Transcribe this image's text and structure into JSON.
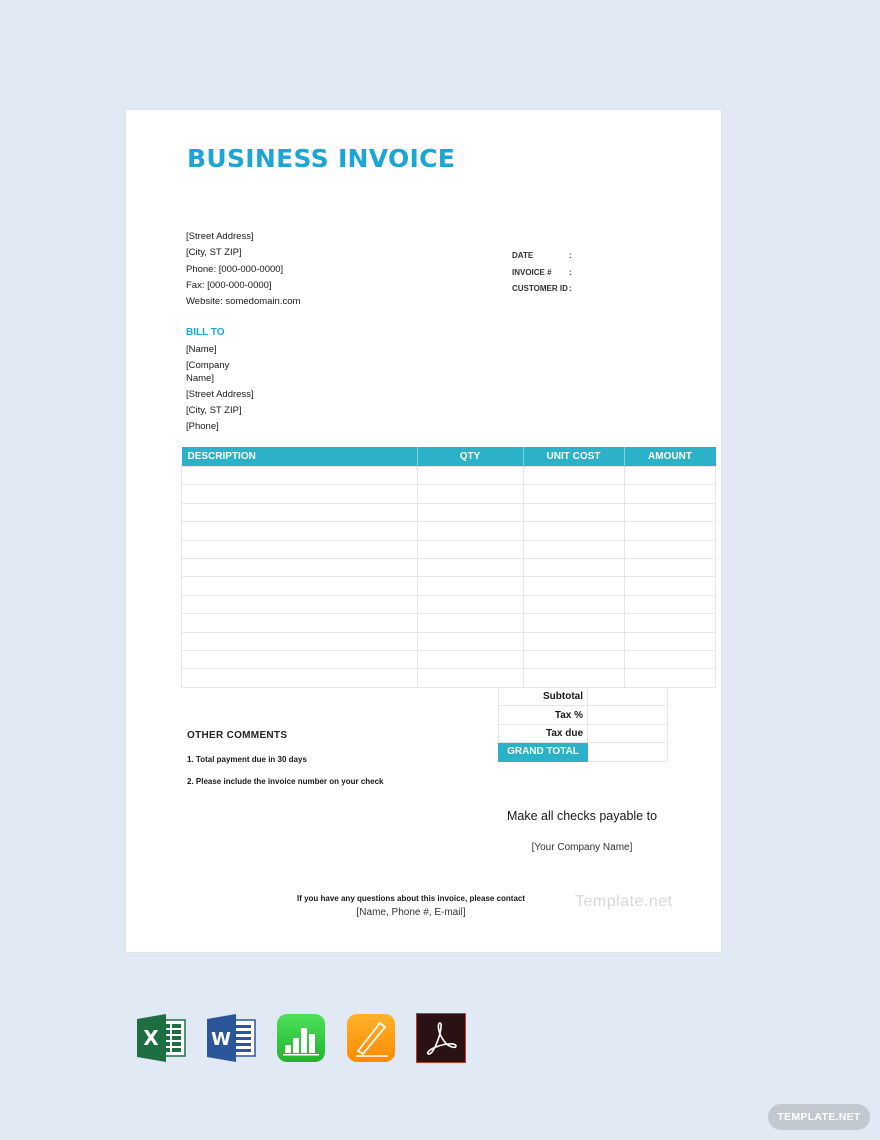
{
  "invoice": {
    "title": "BUSINESS INVOICE",
    "sender": {
      "street": "[Street Address]",
      "city": "[City, ST  ZIP]",
      "phone": "Phone: [000-000-0000]",
      "fax": "Fax: [000-000-0000]",
      "website": "Website: somedomain.com"
    },
    "meta": [
      {
        "label": "DATE",
        "sep": ":",
        "value": ""
      },
      {
        "label": "INVOICE #",
        "sep": ":",
        "value": ""
      },
      {
        "label": "CUSTOMER ID",
        "sep": ":",
        "value": ""
      }
    ],
    "bill_to": {
      "heading": "BILL TO",
      "name": "[Name]",
      "company": "[Company Name]",
      "street": "[Street Address]",
      "city": "[City, ST  ZIP]",
      "phone": "[Phone]"
    },
    "items_table": {
      "columns": [
        "DESCRIPTION",
        "QTY",
        "UNIT COST",
        "AMOUNT"
      ],
      "rows": [
        [
          "",
          "",
          "",
          ""
        ],
        [
          "",
          "",
          "",
          ""
        ],
        [
          "",
          "",
          "",
          ""
        ],
        [
          "",
          "",
          "",
          ""
        ],
        [
          "",
          "",
          "",
          ""
        ],
        [
          "",
          "",
          "",
          ""
        ],
        [
          "",
          "",
          "",
          ""
        ],
        [
          "",
          "",
          "",
          ""
        ],
        [
          "",
          "",
          "",
          ""
        ],
        [
          "",
          "",
          "",
          ""
        ],
        [
          "",
          "",
          "",
          ""
        ],
        [
          "",
          "",
          "",
          ""
        ]
      ]
    },
    "totals": [
      {
        "label": "Subtotal",
        "value": ""
      },
      {
        "label": "Tax %",
        "value": ""
      },
      {
        "label": "Tax due",
        "value": ""
      },
      {
        "label": "GRAND TOTAL",
        "value": ""
      }
    ],
    "comments": {
      "heading": "OTHER COMMENTS",
      "items": [
        "1. Total payment due in 30 days",
        "2. Please include the invoice number on your check"
      ]
    },
    "payable": {
      "text": "Make all checks payable to",
      "company": "[Your Company Name]"
    },
    "contact": {
      "line1": "If you have any questions about this invoice, please contact",
      "line2": "[Name,   Phone #,   E-mail]"
    },
    "watermark": "Template.net"
  },
  "formats": [
    {
      "name": "excel-icon",
      "label": "Microsoft Excel",
      "color": "#1d6f42"
    },
    {
      "name": "word-icon",
      "label": "Microsoft Word",
      "color": "#2b579a"
    },
    {
      "name": "numbers-icon",
      "label": "Apple Numbers",
      "color": "#2ecc40"
    },
    {
      "name": "pages-icon",
      "label": "Apple Pages",
      "color": "#ff9a00"
    },
    {
      "name": "acrobat-icon",
      "label": "Adobe PDF",
      "color": "#2a1113"
    }
  ],
  "brand_badge": "TEMPLATE.NET",
  "colors": {
    "accent": "#2bb2c9",
    "title": "#1da5d6",
    "background": "#e0e9f4"
  }
}
